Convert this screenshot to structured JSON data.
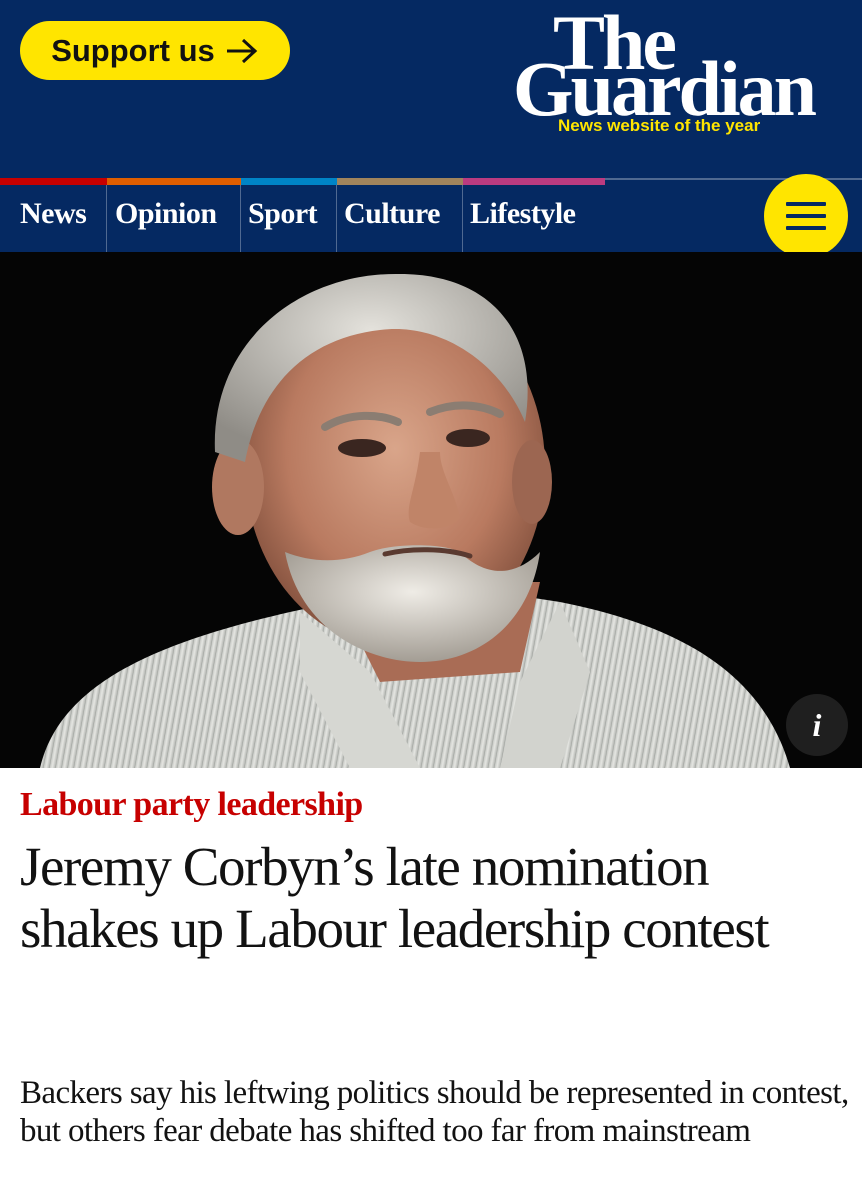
{
  "header": {
    "support_label": "Support us",
    "logo_line1": "The",
    "logo_line2": "Guardian",
    "tagline": "News website of the year",
    "colors": {
      "background": "#052962",
      "accent": "#ffe500"
    }
  },
  "nav": {
    "pillars": [
      {
        "label": "News",
        "color": "#c70000"
      },
      {
        "label": "Opinion",
        "color": "#e05e00"
      },
      {
        "label": "Sport",
        "color": "#0084c6"
      },
      {
        "label": "Culture",
        "color": "#a1845c"
      },
      {
        "label": "Lifestyle",
        "color": "#bb3b80"
      }
    ],
    "menu_icon": "hamburger-menu-icon"
  },
  "hero": {
    "info_label": "i"
  },
  "article": {
    "kicker": "Labour party leadership",
    "kicker_color": "#c70000",
    "headline": "Jeremy Corbyn’s late nomination shakes up Labour leadership contest",
    "standfirst": "Backers say his leftwing politics should be represented in contest, but others fear debate has shifted too far from mainstream"
  }
}
